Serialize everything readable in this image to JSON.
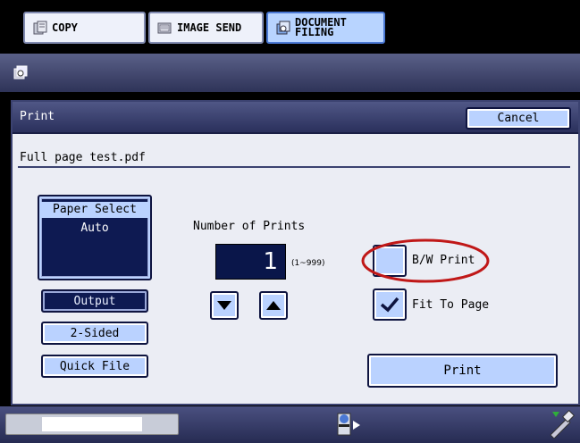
{
  "tabs": [
    {
      "label": "COPY",
      "icon": "copy-icon"
    },
    {
      "label": "IMAGE SEND",
      "icon": "image-send-icon"
    },
    {
      "label_line1": "DOCUMENT",
      "label_line2": "FILING",
      "icon": "document-filing-icon",
      "active": true
    }
  ],
  "header_icon": "document-filing-icon",
  "dialog": {
    "title": "Print",
    "cancel_label": "Cancel",
    "filename": "Full page test.pdf"
  },
  "paper_select": {
    "label": "Paper Select",
    "value": "Auto"
  },
  "side_buttons": {
    "output_label": "Output",
    "two_sided_label": "2-Sided",
    "quick_file_label": "Quick File"
  },
  "prints": {
    "label": "Number of Prints",
    "value": "1",
    "range": "(1~999)"
  },
  "options": {
    "bw_print_label": "B/W Print",
    "bw_print_checked": false,
    "fit_to_page_label": "Fit To Page",
    "fit_to_page_checked": true
  },
  "print_button_label": "Print",
  "colors": {
    "accent": "#bad2ff",
    "dark_button": "#0e1a52",
    "highlight_circle": "#c01818"
  }
}
